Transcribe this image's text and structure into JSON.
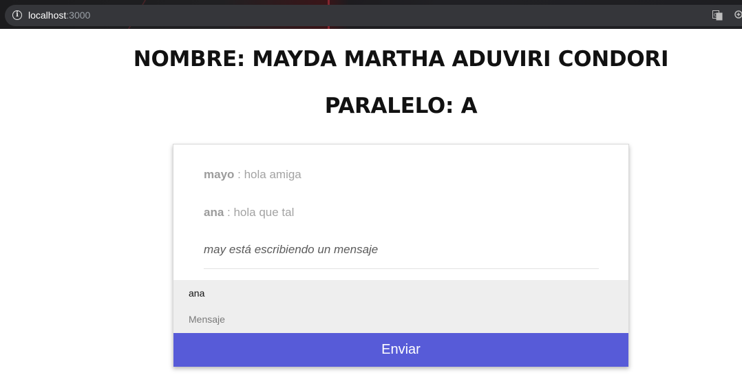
{
  "browser": {
    "url_host": "localhost",
    "url_port": ":3000",
    "icons": [
      "info-icon",
      "translate-icon",
      "zoom-icon"
    ]
  },
  "page": {
    "name_heading": "NOMBRE: MAYDA MARTHA ADUVIRI CONDORI",
    "paralelo_heading": "PARALELO: A"
  },
  "chat": {
    "messages": [
      {
        "user": "mayo",
        "text": " : hola amiga"
      },
      {
        "user": "ana",
        "text": " : hola que tal"
      }
    ],
    "typing": "may está escribiendo un mensaje",
    "user_input_value": "ana",
    "message_placeholder": "Mensaje",
    "send_label": "Enviar"
  },
  "colors": {
    "send_button": "#575bd8",
    "form_background": "#eeeeee"
  }
}
